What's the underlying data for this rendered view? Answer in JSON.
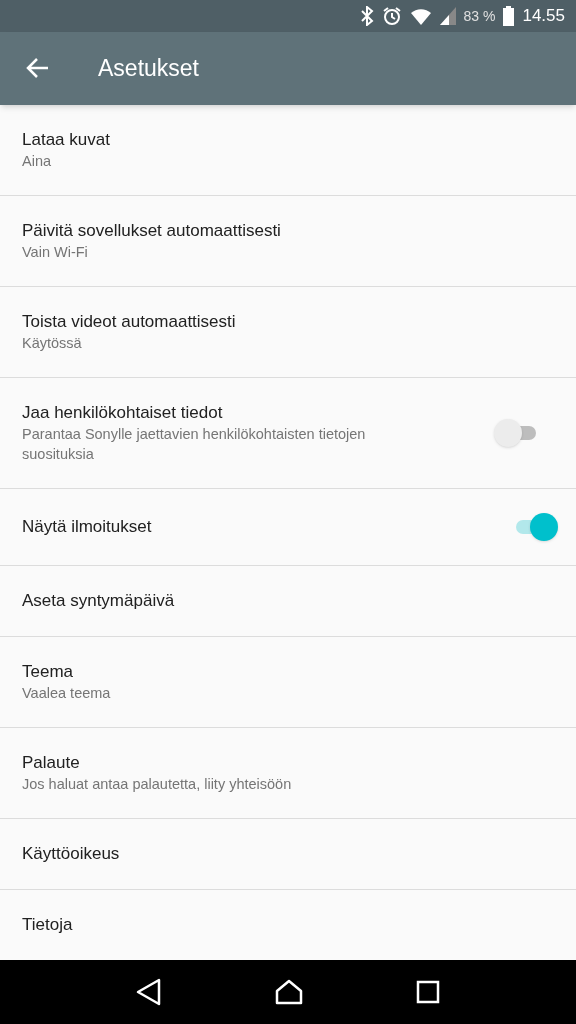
{
  "status_bar": {
    "battery_text": "83 %",
    "time": "14.55"
  },
  "app_bar": {
    "title": "Asetukset"
  },
  "items": [
    {
      "kind": "text",
      "title": "Lataa kuvat",
      "subtitle": "Aina"
    },
    {
      "kind": "text",
      "title": "Päivitä sovellukset automaattisesti",
      "subtitle": "Vain Wi-Fi"
    },
    {
      "kind": "text",
      "title": "Toista videot automaattisesti",
      "subtitle": "Käytössä"
    },
    {
      "kind": "toggle",
      "title": "Jaa henkilökohtaiset tiedot",
      "subtitle": "Parantaa Sonylle jaettavien henkilökohtaisten tietojen suosituksia",
      "on": false
    },
    {
      "kind": "toggle",
      "title": "Näytä ilmoitukset",
      "on": true
    },
    {
      "kind": "text",
      "title": "Aseta syntymäpäivä"
    },
    {
      "kind": "text",
      "title": "Teema",
      "subtitle": "Vaalea teema"
    },
    {
      "kind": "text",
      "title": "Palaute",
      "subtitle": "Jos haluat antaa palautetta, liity yhteisöön"
    },
    {
      "kind": "text",
      "title": "Käyttöoikeus"
    },
    {
      "kind": "text",
      "title": "Tietoja"
    }
  ]
}
